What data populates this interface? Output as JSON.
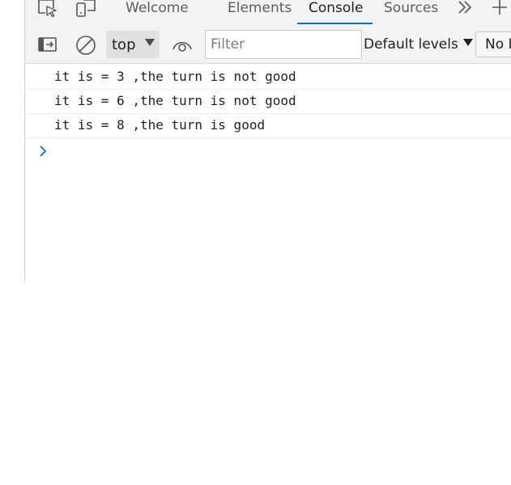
{
  "tabs": [
    {
      "label": "Welcome",
      "active": false
    },
    {
      "label": "Elements",
      "active": false
    },
    {
      "label": "Console",
      "active": true
    },
    {
      "label": "Sources",
      "active": false
    }
  ],
  "toolbar": {
    "context": "top",
    "filter_placeholder": "Filter",
    "levels_label": "Default levels",
    "issues_label": "No I"
  },
  "console": {
    "messages": [
      "it is = 3 ,the turn is not good",
      "it is = 6 ,the turn is not good",
      "it is = 8 ,the turn is good"
    ]
  },
  "icons": [
    "inspect-element-icon",
    "device-emulation-icon",
    "more-tabs-icon",
    "add-tab-icon",
    "sidebar-toggle-icon",
    "clear-console-icon",
    "live-expression-icon",
    "prompt-chevron-icon"
  ],
  "colors": {
    "accent": "#0f6cbd",
    "toolbar_bg": "#f3f3f3"
  }
}
